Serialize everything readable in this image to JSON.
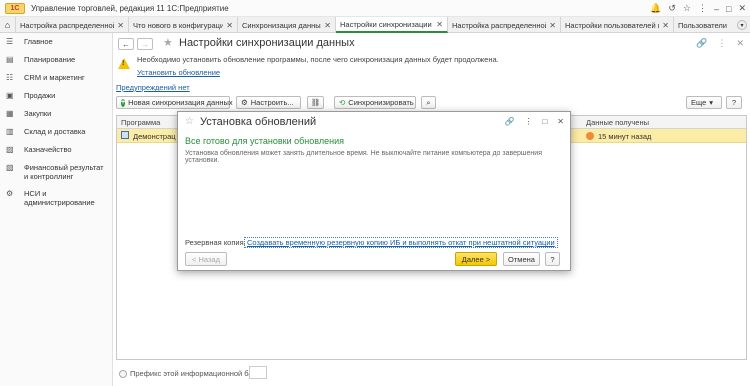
{
  "app": {
    "logo": "1С",
    "title": "Управление торговлей, редакция 11 1С:Предприятие"
  },
  "tabs": [
    {
      "label": "Настройка распределенной..."
    },
    {
      "label": "Что нового в конфигурации ..."
    },
    {
      "label": "Синхронизация данных"
    },
    {
      "label": "Настройки синхронизации д..."
    },
    {
      "label": "Настройка распределенной ..."
    },
    {
      "label": "Настройки пользователей и..."
    },
    {
      "label": "Пользователи"
    }
  ],
  "sidebar": {
    "items": [
      {
        "label": "Главное",
        "icon": "menu-icon"
      },
      {
        "label": "Планирование",
        "icon": "planning-icon"
      },
      {
        "label": "CRM и маркетинг",
        "icon": "crm-icon"
      },
      {
        "label": "Продажи",
        "icon": "sales-icon"
      },
      {
        "label": "Закупки",
        "icon": "purchases-icon"
      },
      {
        "label": "Склад и доставка",
        "icon": "warehouse-icon"
      },
      {
        "label": "Казначейство",
        "icon": "treasury-icon"
      },
      {
        "label": "Финансовый результат и контроллинг",
        "icon": "finance-icon"
      },
      {
        "label": "НСИ и администрирование",
        "icon": "admin-icon"
      }
    ]
  },
  "main": {
    "title": "Настройки синхронизации данных",
    "warning": {
      "text": "Необходимо установить обновление программы, после чего синхронизация данных будет продолжена.",
      "link": "Установить обновление"
    },
    "preview_link": "Предупреждений нет",
    "toolbar": {
      "new_sync": "Новая синхронизация данных",
      "configure": "Настроить...",
      "synchronize": "Синхронизировать",
      "more": "Еще",
      "help": "?"
    },
    "grid": {
      "col_program": "Программа",
      "col_received": "Данные получены",
      "row": {
        "program": "Демонстрац",
        "received": "15 минут назад"
      }
    },
    "footer": {
      "prefix_label": "Префикс этой информационной базы"
    }
  },
  "dialog": {
    "title": "Установка обновлений",
    "heading": "Все готово для установки обновления",
    "text": "Установка обновления может занять длительное время. Не выключайте питание компьютера до завершения установки.",
    "backup_label": "Резервная копия:",
    "backup_link": "Создавать временную резервную копию ИБ и выполнять откат при нештатной ситуации",
    "back": "< Назад",
    "next": "Далее >",
    "cancel": "Отмена",
    "help": "?"
  },
  "colors": {
    "accent_green": "#2a8c3c",
    "row_highlight": "#fbeca6",
    "primary_button": "#f5c700",
    "link": "#1b5fa8"
  }
}
